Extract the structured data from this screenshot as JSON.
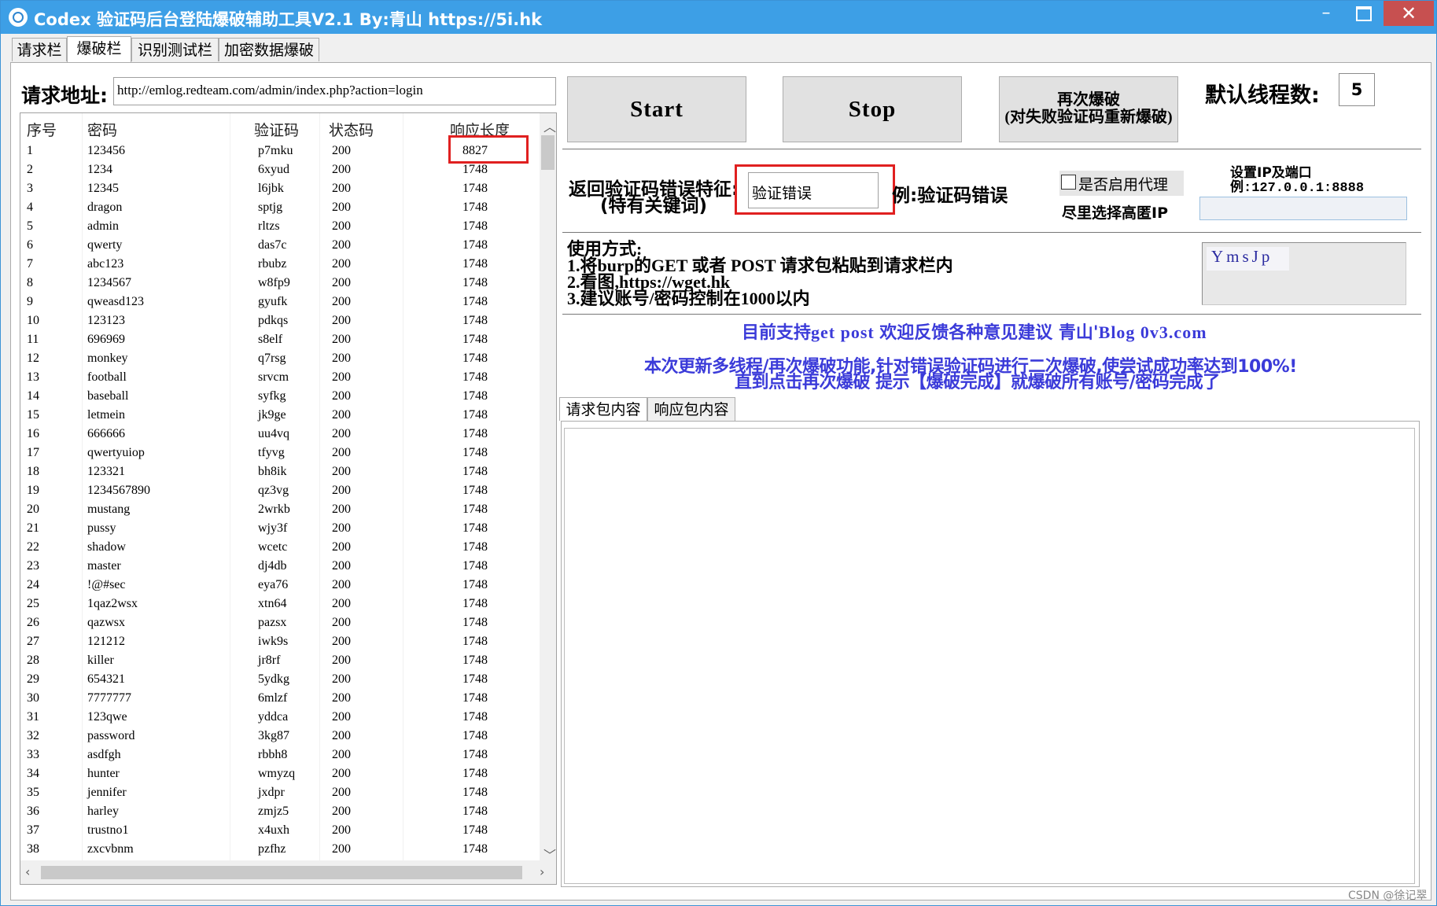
{
  "window": {
    "title": "Codex 验证码后台登陆爆破辅助工具V2.1  By:青山 https://5i.hk",
    "minimize": "–",
    "close": "✕"
  },
  "tabs": [
    {
      "label": "请求栏"
    },
    {
      "label": "爆破栏"
    },
    {
      "label": "识别测试栏"
    },
    {
      "label": "加密数据爆破"
    }
  ],
  "request": {
    "label": "请求地址:",
    "url": "http://emlog.redteam.com/admin/index.php?action=login"
  },
  "table": {
    "headers": [
      "序号",
      "密码",
      "验证码",
      "状态码",
      "响应长度"
    ],
    "rows": [
      [
        "1",
        "123456",
        "p7mku",
        "200",
        "8827"
      ],
      [
        "2",
        "1234",
        "6xyud",
        "200",
        "1748"
      ],
      [
        "3",
        "12345",
        "l6jbk",
        "200",
        "1748"
      ],
      [
        "4",
        "dragon",
        "sptjg",
        "200",
        "1748"
      ],
      [
        "5",
        "admin",
        "rltzs",
        "200",
        "1748"
      ],
      [
        "6",
        "qwerty",
        "das7c",
        "200",
        "1748"
      ],
      [
        "7",
        "abc123",
        "rbubz",
        "200",
        "1748"
      ],
      [
        "8",
        "1234567",
        "w8fp9",
        "200",
        "1748"
      ],
      [
        "9",
        "qweasd123",
        "gyufk",
        "200",
        "1748"
      ],
      [
        "10",
        "123123",
        "pdkqs",
        "200",
        "1748"
      ],
      [
        "11",
        "696969",
        "s8elf",
        "200",
        "1748"
      ],
      [
        "12",
        "monkey",
        "q7rsg",
        "200",
        "1748"
      ],
      [
        "13",
        "football",
        "srvcm",
        "200",
        "1748"
      ],
      [
        "14",
        "baseball",
        "syfkg",
        "200",
        "1748"
      ],
      [
        "15",
        "letmein",
        "jk9ge",
        "200",
        "1748"
      ],
      [
        "16",
        "666666",
        "uu4vq",
        "200",
        "1748"
      ],
      [
        "17",
        "qwertyuiop",
        "tfyvg",
        "200",
        "1748"
      ],
      [
        "18",
        "123321",
        "bh8ik",
        "200",
        "1748"
      ],
      [
        "19",
        "1234567890",
        "qz3vg",
        "200",
        "1748"
      ],
      [
        "20",
        "mustang",
        "2wrkb",
        "200",
        "1748"
      ],
      [
        "21",
        "pussy",
        "wjy3f",
        "200",
        "1748"
      ],
      [
        "22",
        "shadow",
        "wcetc",
        "200",
        "1748"
      ],
      [
        "23",
        "master",
        "dj4db",
        "200",
        "1748"
      ],
      [
        "24",
        "!@#sec",
        "eya76",
        "200",
        "1748"
      ],
      [
        "25",
        "1qaz2wsx",
        "xtn64",
        "200",
        "1748"
      ],
      [
        "26",
        "qazwsx",
        "pazsx",
        "200",
        "1748"
      ],
      [
        "27",
        "121212",
        "iwk9s",
        "200",
        "1748"
      ],
      [
        "28",
        "killer",
        "jr8rf",
        "200",
        "1748"
      ],
      [
        "29",
        "654321",
        "5ydkg",
        "200",
        "1748"
      ],
      [
        "30",
        "7777777",
        "6mlzf",
        "200",
        "1748"
      ],
      [
        "31",
        "123qwe",
        "yddca",
        "200",
        "1748"
      ],
      [
        "32",
        "password",
        "3kg87",
        "200",
        "1748"
      ],
      [
        "33",
        "asdfgh",
        "rbbh8",
        "200",
        "1748"
      ],
      [
        "34",
        "hunter",
        "wmyzq",
        "200",
        "1748"
      ],
      [
        "35",
        "jennifer",
        "jxdpr",
        "200",
        "1748"
      ],
      [
        "36",
        "harley",
        "zmjz5",
        "200",
        "1748"
      ],
      [
        "37",
        "trustno1",
        "x4uxh",
        "200",
        "1748"
      ],
      [
        "38",
        "zxcvbnm",
        "pzfhz",
        "200",
        "1748"
      ]
    ]
  },
  "controls": {
    "start": "Start",
    "stop": "Stop",
    "retry_line1": "再次爆破",
    "retry_line2": "(对失败验证码重新爆破)",
    "threads_label": "默认线程数:",
    "threads_value": "5"
  },
  "error_feature": {
    "label_line1": "返回验证码错误特征:",
    "label_line2": "(特有关键词)",
    "value": "验证错误",
    "example": "例:验证码错误"
  },
  "proxy": {
    "checkbox_label": "是否启用代理",
    "hint": "尽里选择高匿IP",
    "ip_title": "设置IP及端口",
    "ip_example": "例:127.0.0.1:8888",
    "ip_value": ""
  },
  "usage": {
    "title": "使用方式:",
    "line1": "1.将burp的GET 或者 POST 请求包粘贴到请求栏内",
    "line2": "2.看图,https://wget.hk",
    "line3": "3.建议账号/密码控制在1000以内"
  },
  "captcha": {
    "text": "YmsJp"
  },
  "info": {
    "support_a": "目前支持",
    "support_b": "get post ",
    "support_c": "欢迎反馈各种意见建议 青山'",
    "support_d": "Blog 0v3.com",
    "notice1": "本次更新多线程/再次爆破功能,针对错误验证码进行二次爆破,使尝试成功率达到100%!",
    "notice2": "直到点击再次爆破 提示【爆破完成】就爆破所有账号/密码完成了"
  },
  "packet_tabs": [
    {
      "label": "请求包内容"
    },
    {
      "label": "响应包内容"
    }
  ],
  "watermark": "CSDN @徐记翠",
  "colors": {
    "titlebar": "#3d9fe6",
    "highlight": "#e02020",
    "info_text": "#3b3bd9"
  }
}
